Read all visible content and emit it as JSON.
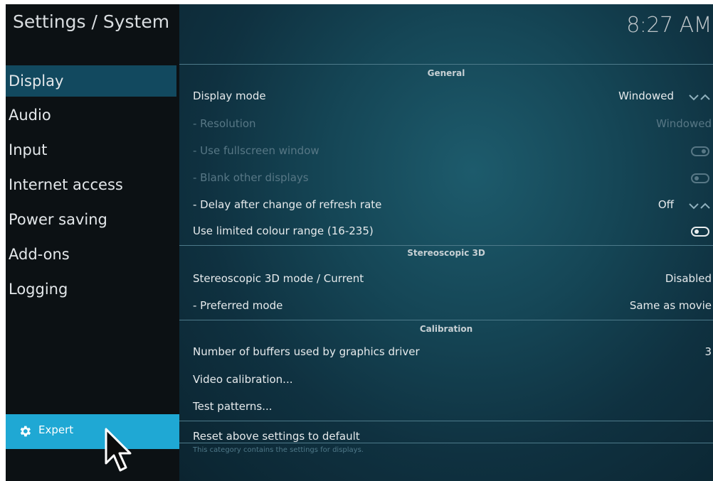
{
  "header": {
    "title": "Settings / System",
    "clock": "8:27 AM"
  },
  "sidebar": {
    "items": [
      {
        "label": "Display",
        "active": true
      },
      {
        "label": "Audio"
      },
      {
        "label": "Input"
      },
      {
        "label": "Internet access"
      },
      {
        "label": "Power saving"
      },
      {
        "label": "Add-ons"
      },
      {
        "label": "Logging"
      }
    ],
    "expert": {
      "label": "Expert",
      "icon": "gear-icon"
    }
  },
  "sections": {
    "general": {
      "title": "General",
      "display_mode": {
        "label": "Display mode",
        "value": "Windowed"
      },
      "resolution": {
        "label": "- Resolution",
        "value": "Windowed"
      },
      "use_fullscreen": {
        "label": "- Use fullscreen window"
      },
      "blank_displays": {
        "label": "- Blank other displays"
      },
      "delay_refresh": {
        "label": "- Delay after change of refresh rate",
        "value": "Off"
      },
      "limited_colour": {
        "label": "Use limited colour range (16-235)"
      }
    },
    "stereo": {
      "title": "Stereoscopic 3D",
      "mode_current": {
        "label": "Stereoscopic 3D mode / Current",
        "value": "Disabled"
      },
      "preferred": {
        "label": "- Preferred mode",
        "value": "Same as movie"
      }
    },
    "calibration": {
      "title": "Calibration",
      "buffers": {
        "label": "Number of buffers used by graphics driver",
        "value": "3"
      },
      "video_calibration": {
        "label": "Video calibration..."
      },
      "test_patterns": {
        "label": "Test patterns..."
      }
    }
  },
  "footer": {
    "reset_label": "Reset above settings to default",
    "description": "This category contains the settings for displays."
  },
  "colors": {
    "active_item": "#12495f",
    "expert_bg": "#1fa8d4",
    "background": "#0b1013"
  }
}
